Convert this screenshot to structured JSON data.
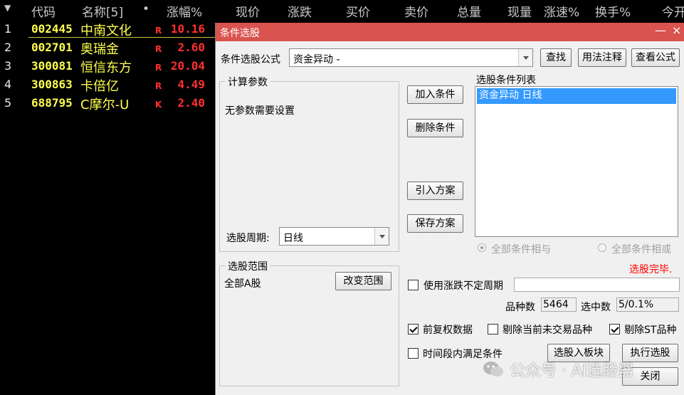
{
  "table": {
    "headers": [
      "代码",
      "名称[5]",
      "•",
      "涨幅%",
      "现价",
      "涨跌",
      "买价",
      "卖价",
      "总量",
      "现量",
      "涨速%",
      "换手%",
      "今开"
    ],
    "rows": [
      {
        "num": "1",
        "code": "002445",
        "name": "中南文化",
        "flag": "R",
        "pct": "10.16"
      },
      {
        "num": "2",
        "code": "002701",
        "name": "奥瑞金",
        "flag": "R",
        "pct": "2.60"
      },
      {
        "num": "3",
        "code": "300081",
        "name": "恒信东方",
        "flag": "R",
        "pct": "20.04"
      },
      {
        "num": "4",
        "code": "300863",
        "name": "卡倍亿",
        "flag": "R",
        "pct": "4.49"
      },
      {
        "num": "5",
        "code": "688795",
        "name": "C摩尔-U",
        "flag": "K",
        "pct": "2.40"
      }
    ]
  },
  "dialog": {
    "title": "条件选股",
    "minimize_glyph": "—",
    "close_glyph": "×",
    "formula_label": "条件选股公式",
    "formula_value": "资金异动  -",
    "btn_find": "查找",
    "btn_usage": "用法注释",
    "btn_view_formula": "查看公式",
    "params_group": "计算参数",
    "params_text": "无参数需要设置",
    "period_label": "选股周期:",
    "period_value": "日线",
    "btn_add": "加入条件",
    "btn_delete": "删除条件",
    "btn_import": "引入方案",
    "btn_save": "保存方案",
    "condition_list_label": "选股条件列表",
    "condition_items": [
      "资金异动  日线"
    ],
    "radio_and": "全部条件相与",
    "radio_or": "全部条件相或",
    "status": "选股完毕.",
    "range_group": "选股范围",
    "range_value": "全部A股",
    "btn_change_range": "改变范围",
    "chk_period": "使用涨跌不定周期",
    "count_label": "品种数",
    "count_value": "5464",
    "selected_label": "选中数",
    "selected_value": "5/0.1%",
    "chk_adjust": "前复权数据",
    "chk_remove_untraded": "剔除当前未交易品种",
    "chk_remove_st": "剔除ST品种",
    "chk_time_range": "时间段内满足条件",
    "btn_to_block": "选股入板块",
    "btn_run": "执行选股",
    "btn_close": "关闭"
  },
  "watermark": "公众号 · AI选股器",
  "colors": {
    "title_bar": "#d9534f",
    "code": "#ffff50",
    "up": "#ff3030",
    "selection": "#3399ff",
    "status": "#ff0000"
  }
}
